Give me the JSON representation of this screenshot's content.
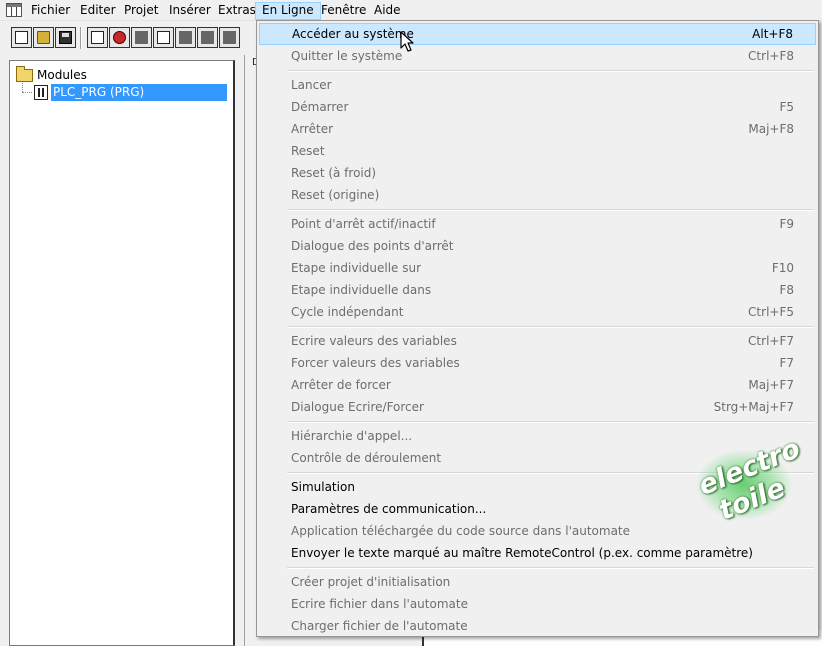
{
  "menubar": {
    "items": [
      "Fichier",
      "Editer",
      "Projet",
      "Insérer",
      "Extras",
      "En Ligne",
      "Fenêtre",
      "Aide"
    ],
    "active": "En Ligne"
  },
  "toolbar": {
    "buttons": [
      "new-file-icon",
      "open-folder-icon",
      "save-icon",
      "login-icon",
      "stop-icon",
      "run-icon",
      "module-icon",
      "print-icon",
      "transfer-icon",
      "build-icon"
    ]
  },
  "tree": {
    "root_label": "Modules",
    "child_label": "PLC_PRG (PRG)"
  },
  "middle": {
    "label": "D"
  },
  "dropdown": {
    "items": [
      {
        "label": "Accéder au système",
        "shortcut": "Alt+F8",
        "enabled": true
      },
      {
        "label": "Quitter le système",
        "shortcut": "Ctrl+F8",
        "enabled": false
      },
      {
        "label": "Lancer",
        "shortcut": "",
        "enabled": false
      },
      {
        "label": "Démarrer",
        "shortcut": "F5",
        "enabled": false
      },
      {
        "label": "Arrêter",
        "shortcut": "Maj+F8",
        "enabled": false
      },
      {
        "label": "Reset",
        "shortcut": "",
        "enabled": false
      },
      {
        "label": "Reset (à froid)",
        "shortcut": "",
        "enabled": false
      },
      {
        "label": "Reset (origine)",
        "shortcut": "",
        "enabled": false
      },
      {
        "label": "Point d'arrêt actif/inactif",
        "shortcut": "F9",
        "enabled": false
      },
      {
        "label": "Dialogue des points d'arrêt",
        "shortcut": "",
        "enabled": false
      },
      {
        "label": "Etape individuelle sur",
        "shortcut": "F10",
        "enabled": false
      },
      {
        "label": "Etape individuelle dans",
        "shortcut": "F8",
        "enabled": false
      },
      {
        "label": "Cycle indépendant",
        "shortcut": "Ctrl+F5",
        "enabled": false
      },
      {
        "label": "Ecrire valeurs des variables",
        "shortcut": "Ctrl+F7",
        "enabled": false
      },
      {
        "label": "Forcer valeurs des variables",
        "shortcut": "F7",
        "enabled": false
      },
      {
        "label": "Arrêter de forcer",
        "shortcut": "Maj+F7",
        "enabled": false
      },
      {
        "label": "Dialogue Ecrire/Forcer",
        "shortcut": "Strg+Maj+F7",
        "enabled": false
      },
      {
        "label": "Hiérarchie d'appel...",
        "shortcut": "",
        "enabled": false
      },
      {
        "label": "Contrôle de déroulement",
        "shortcut": "",
        "enabled": false
      },
      {
        "label": "Simulation",
        "shortcut": "",
        "enabled": true
      },
      {
        "label": "Paramètres de communication...",
        "shortcut": "",
        "enabled": true
      },
      {
        "label": "Application téléchargée du code source dans l'automate",
        "shortcut": "",
        "enabled": false
      },
      {
        "label": "Envoyer le texte marqué au maître RemoteControl  (p.ex. comme paramètre)",
        "shortcut": "",
        "enabled": true
      },
      {
        "label": "Créer projet d'initialisation",
        "shortcut": "",
        "enabled": false
      },
      {
        "label": "Ecrire fichier dans l'automate",
        "shortcut": "",
        "enabled": false
      },
      {
        "label": "Charger fichier de l'automate",
        "shortcut": "",
        "enabled": false
      }
    ]
  },
  "watermark": {
    "line1": "electro",
    "line2": "toile"
  },
  "colors": {
    "highlight": "#cce8ff",
    "selection": "#3399ff",
    "disabled_text": "#6d6d6d"
  }
}
